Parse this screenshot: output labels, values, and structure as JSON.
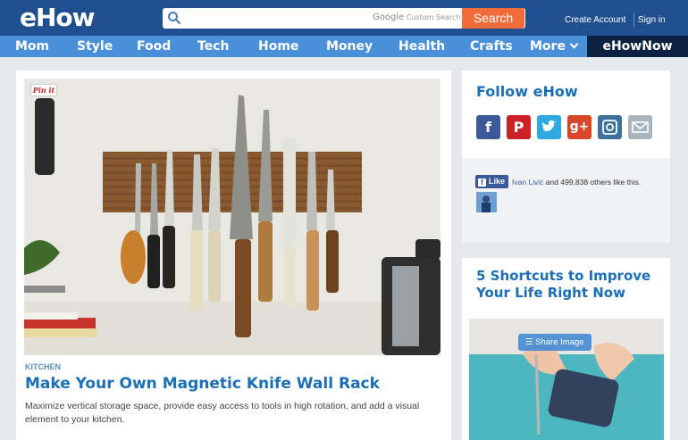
{
  "header": {
    "logo": "eHow",
    "search_placeholder": "",
    "google_label_brand": "Google",
    "google_label_text": " Custom Search",
    "search_button": "Search",
    "create_account": "Create Account",
    "sign_in": "Sign in"
  },
  "nav": {
    "items": [
      "Mom",
      "Style",
      "Food",
      "Tech",
      "Home",
      "Money",
      "Health",
      "Crafts",
      "More"
    ],
    "highlight": "eHowNow"
  },
  "article": {
    "pinit": "Pin it",
    "category": "KITCHEN",
    "title": "Make Your Own Magnetic Knife Wall Rack",
    "description": "Maximize vertical storage space, provide easy access to tools in high rotation, and add a visual element to your kitchen."
  },
  "follow": {
    "title": "Follow eHow",
    "icons": [
      "facebook-icon",
      "pinterest-icon",
      "twitter-icon",
      "google-plus-icon",
      "instagram-icon",
      "email-icon"
    ],
    "like_label": "Like",
    "like_user": "Ivan Livić",
    "like_rest": " and 499,838 others like this."
  },
  "shortcuts": {
    "title": "5 Shortcuts to Improve Your Life Right Now",
    "share_image": "Share Image"
  },
  "colors": {
    "header_bg": "#1f4f8e",
    "nav_bg": "#4a90d9",
    "accent_orange": "#f26b3a",
    "link_blue": "#1a6fb8"
  }
}
